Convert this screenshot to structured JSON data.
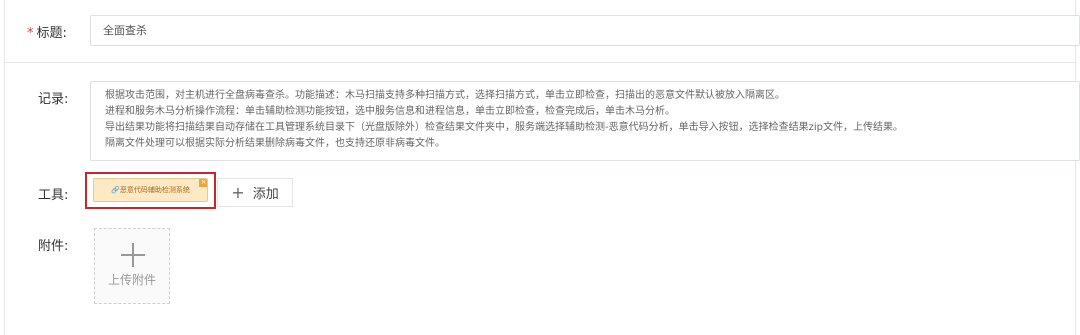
{
  "form": {
    "title": {
      "required_mark": "*",
      "label": "标题:",
      "value": "全面查杀"
    },
    "record": {
      "label": "记录:",
      "lines": [
        "根据攻击范围，对主机进行全盘病毒查杀。功能描述：木马扫描支持多种扫描方式，选择扫描方式，单击立即检查，扫描出的恶意文件默认被放入隔离区。",
        "进程和服务木马分析操作流程：单击辅助检测功能按钮，选中服务信息和进程信息，单击立即检查，检查完成后，单击木马分析。",
        "导出结果功能将扫描结果自动存储在工具管理系统目录下（光盘版除外）检查结果文件夹中，服务端选择辅助检测-恶意代码分析，单击导入按钮，选择检查结果zip文件，上传结果。",
        "隔离文件处理可以根据实际分析结果删除病毒文件，也支持还原非病毒文件。"
      ]
    },
    "tools": {
      "label": "工具:",
      "chip_label": "🔗恶意代码辅助检测系统",
      "chip_close": "×",
      "add_label": "添加",
      "add_icon": "plus-icon"
    },
    "attachment": {
      "label": "附件:",
      "upload_label": "上传附件",
      "upload_icon": "plus-icon"
    }
  },
  "colors": {
    "required": "#e4393c",
    "highlight_border": "#c9252b",
    "chip_bg": "#fde9c4",
    "chip_text": "#b06a18"
  }
}
